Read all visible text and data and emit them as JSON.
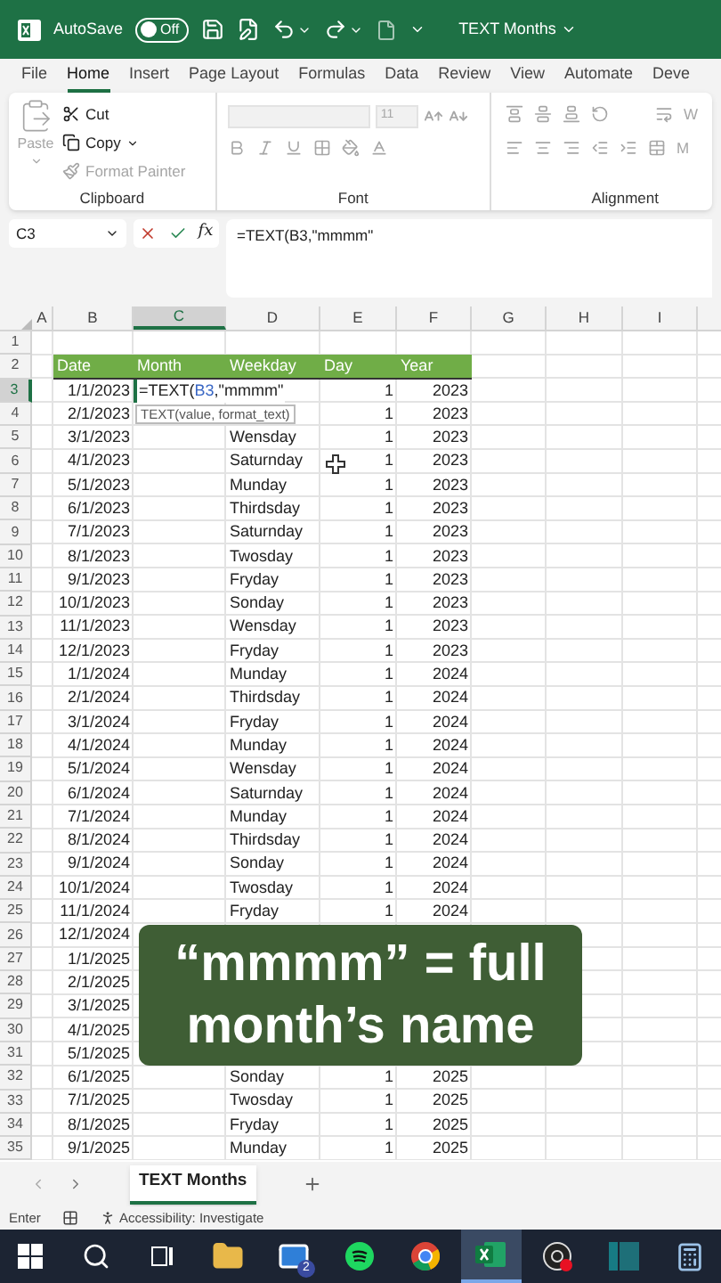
{
  "title_bar": {
    "autosave_label": "AutoSave",
    "autosave_toggle": {
      "label": "Off",
      "on": false
    },
    "document_title": "TEXT Months"
  },
  "ribbon_tabs": [
    {
      "label": "File",
      "selected": false
    },
    {
      "label": "Home",
      "selected": true
    },
    {
      "label": "Insert",
      "selected": false
    },
    {
      "label": "Page Layout",
      "selected": false
    },
    {
      "label": "Formulas",
      "selected": false
    },
    {
      "label": "Data",
      "selected": false
    },
    {
      "label": "Review",
      "selected": false
    },
    {
      "label": "View",
      "selected": false
    },
    {
      "label": "Automate",
      "selected": false
    },
    {
      "label": "Deve",
      "selected": false
    }
  ],
  "ribbon": {
    "clipboard": {
      "paste": {
        "label": "Paste",
        "disabled": true
      },
      "items": [
        {
          "kind": "cut",
          "label": "Cut",
          "disabled": false
        },
        {
          "kind": "copy",
          "label": "Copy",
          "disabled": false
        },
        {
          "kind": "painter",
          "label": "Format Painter",
          "disabled": true
        }
      ],
      "group_label": "Clipboard"
    },
    "font": {
      "size": "11",
      "group_label": "Font"
    },
    "alignment": {
      "group_label": "Alignment",
      "wrap_label": "W",
      "merge_label": "M"
    }
  },
  "formula_bar": {
    "name_box": "C3",
    "function_label": "fx",
    "formula": "=TEXT(B3,\"mmmm\""
  },
  "grid": {
    "columns": [
      {
        "label": "A",
        "selected": false
      },
      {
        "label": "B",
        "selected": false
      },
      {
        "label": "C",
        "selected": true
      },
      {
        "label": "D",
        "selected": false
      },
      {
        "label": "E",
        "selected": false
      },
      {
        "label": "F",
        "selected": false
      },
      {
        "label": "G",
        "selected": false
      },
      {
        "label": "H",
        "selected": false
      },
      {
        "label": "I",
        "selected": false
      }
    ],
    "tooltip": "TEXT(value, format_text)",
    "rows": [
      {
        "number": "1",
        "selected": false,
        "cells": {}
      },
      {
        "number": "2",
        "selected": false,
        "header": true,
        "cells": {
          "B": "Date",
          "C": "Month",
          "D": "Weekday",
          "E": "Day",
          "F": "Year"
        }
      },
      {
        "number": "3",
        "selected": true,
        "header": false,
        "cells": {
          "B": "1/1/2023",
          "C": {
            "prefix": "=TEXT(",
            "ref": "B3",
            "suffix": ",\"mmmm\""
          },
          "E": "1",
          "F": "2023"
        }
      },
      {
        "number": "4",
        "selected": false,
        "header": false,
        "cells": {
          "B": "2/1/2023",
          "E": "1",
          "F": "2023"
        }
      },
      {
        "number": "5",
        "selected": false,
        "header": false,
        "cells": {
          "B": "3/1/2023",
          "D": "Wensday",
          "E": "1",
          "F": "2023"
        }
      },
      {
        "number": "6",
        "selected": false,
        "header": false,
        "cells": {
          "B": "4/1/2023",
          "D": "Saturnday",
          "E": "1",
          "F": "2023"
        }
      },
      {
        "number": "7",
        "selected": false,
        "header": false,
        "cells": {
          "B": "5/1/2023",
          "D": "Munday",
          "E": "1",
          "F": "2023"
        }
      },
      {
        "number": "8",
        "selected": false,
        "header": false,
        "cells": {
          "B": "6/1/2023",
          "D": "Thirdsday",
          "E": "1",
          "F": "2023"
        }
      },
      {
        "number": "9",
        "selected": false,
        "header": false,
        "cells": {
          "B": "7/1/2023",
          "D": "Saturnday",
          "E": "1",
          "F": "2023"
        }
      },
      {
        "number": "10",
        "selected": false,
        "header": false,
        "cells": {
          "B": "8/1/2023",
          "D": "Twosday",
          "E": "1",
          "F": "2023"
        }
      },
      {
        "number": "11",
        "selected": false,
        "header": false,
        "cells": {
          "B": "9/1/2023",
          "D": "Fryday",
          "E": "1",
          "F": "2023"
        }
      },
      {
        "number": "12",
        "selected": false,
        "header": false,
        "cells": {
          "B": "10/1/2023",
          "D": "Sonday",
          "E": "1",
          "F": "2023"
        }
      },
      {
        "number": "13",
        "selected": false,
        "header": false,
        "cells": {
          "B": "11/1/2023",
          "D": "Wensday",
          "E": "1",
          "F": "2023"
        }
      },
      {
        "number": "14",
        "selected": false,
        "header": false,
        "cells": {
          "B": "12/1/2023",
          "D": "Fryday",
          "E": "1",
          "F": "2023"
        }
      },
      {
        "number": "15",
        "selected": false,
        "header": false,
        "cells": {
          "B": "1/1/2024",
          "D": "Munday",
          "E": "1",
          "F": "2024"
        }
      },
      {
        "number": "16",
        "selected": false,
        "header": false,
        "cells": {
          "B": "2/1/2024",
          "D": "Thirdsday",
          "E": "1",
          "F": "2024"
        }
      },
      {
        "number": "17",
        "selected": false,
        "header": false,
        "cells": {
          "B": "3/1/2024",
          "D": "Fryday",
          "E": "1",
          "F": "2024"
        }
      },
      {
        "number": "18",
        "selected": false,
        "header": false,
        "cells": {
          "B": "4/1/2024",
          "D": "Munday",
          "E": "1",
          "F": "2024"
        }
      },
      {
        "number": "19",
        "selected": false,
        "header": false,
        "cells": {
          "B": "5/1/2024",
          "D": "Wensday",
          "E": "1",
          "F": "2024"
        }
      },
      {
        "number": "20",
        "selected": false,
        "header": false,
        "cells": {
          "B": "6/1/2024",
          "D": "Saturnday",
          "E": "1",
          "F": "2024"
        }
      },
      {
        "number": "21",
        "selected": false,
        "header": false,
        "cells": {
          "B": "7/1/2024",
          "D": "Munday",
          "E": "1",
          "F": "2024"
        }
      },
      {
        "number": "22",
        "selected": false,
        "header": false,
        "cells": {
          "B": "8/1/2024",
          "D": "Thirdsday",
          "E": "1",
          "F": "2024"
        }
      },
      {
        "number": "23",
        "selected": false,
        "header": false,
        "cells": {
          "B": "9/1/2024",
          "D": "Sonday",
          "E": "1",
          "F": "2024"
        }
      },
      {
        "number": "24",
        "selected": false,
        "header": false,
        "cells": {
          "B": "10/1/2024",
          "D": "Twosday",
          "E": "1",
          "F": "2024"
        }
      },
      {
        "number": "25",
        "selected": false,
        "header": false,
        "cells": {
          "B": "11/1/2024",
          "D": "Fryday",
          "E": "1",
          "F": "2024"
        }
      },
      {
        "number": "26",
        "selected": false,
        "header": false,
        "cells": {
          "B": "12/1/2024"
        }
      },
      {
        "number": "27",
        "selected": false,
        "header": false,
        "cells": {
          "B": "1/1/2025"
        }
      },
      {
        "number": "28",
        "selected": false,
        "header": false,
        "cells": {
          "B": "2/1/2025"
        }
      },
      {
        "number": "29",
        "selected": false,
        "header": false,
        "cells": {
          "B": "3/1/2025"
        }
      },
      {
        "number": "30",
        "selected": false,
        "header": false,
        "cells": {
          "B": "4/1/2025"
        }
      },
      {
        "number": "31",
        "selected": false,
        "header": false,
        "cells": {
          "B": "5/1/2025"
        }
      },
      {
        "number": "32",
        "selected": false,
        "header": false,
        "cells": {
          "B": "6/1/2025",
          "D": "Sonday",
          "E": "1",
          "F": "2025"
        }
      },
      {
        "number": "33",
        "selected": false,
        "header": false,
        "cells": {
          "B": "7/1/2025",
          "D": "Twosday",
          "E": "1",
          "F": "2025"
        }
      },
      {
        "number": "34",
        "selected": false,
        "header": false,
        "cells": {
          "B": "8/1/2025",
          "D": "Fryday",
          "E": "1",
          "F": "2025"
        }
      },
      {
        "number": "35",
        "selected": false,
        "header": false,
        "cells": {
          "B": "9/1/2025",
          "D": "Munday",
          "E": "1",
          "F": "2025"
        }
      }
    ]
  },
  "caption": {
    "lines": [
      "“mmmm” = full",
      "month’s name"
    ]
  },
  "sheet_tabs": [
    {
      "label": "TEXT Months",
      "selected": true
    }
  ],
  "status_bar": {
    "mode": "Enter",
    "accessibility": "Accessibility: Investigate"
  },
  "taskbar": [
    {
      "kind": "start",
      "active": false
    },
    {
      "kind": "search",
      "active": false
    },
    {
      "kind": "taskview",
      "active": false
    },
    {
      "kind": "folder",
      "active": false
    },
    {
      "kind": "mail",
      "active": false,
      "badge": "2"
    },
    {
      "kind": "music",
      "active": false
    },
    {
      "kind": "browser",
      "active": false
    },
    {
      "kind": "excel",
      "active": true
    },
    {
      "kind": "recorder",
      "active": false
    },
    {
      "kind": "panel",
      "active": false
    },
    {
      "kind": "calculator",
      "active": false
    }
  ]
}
